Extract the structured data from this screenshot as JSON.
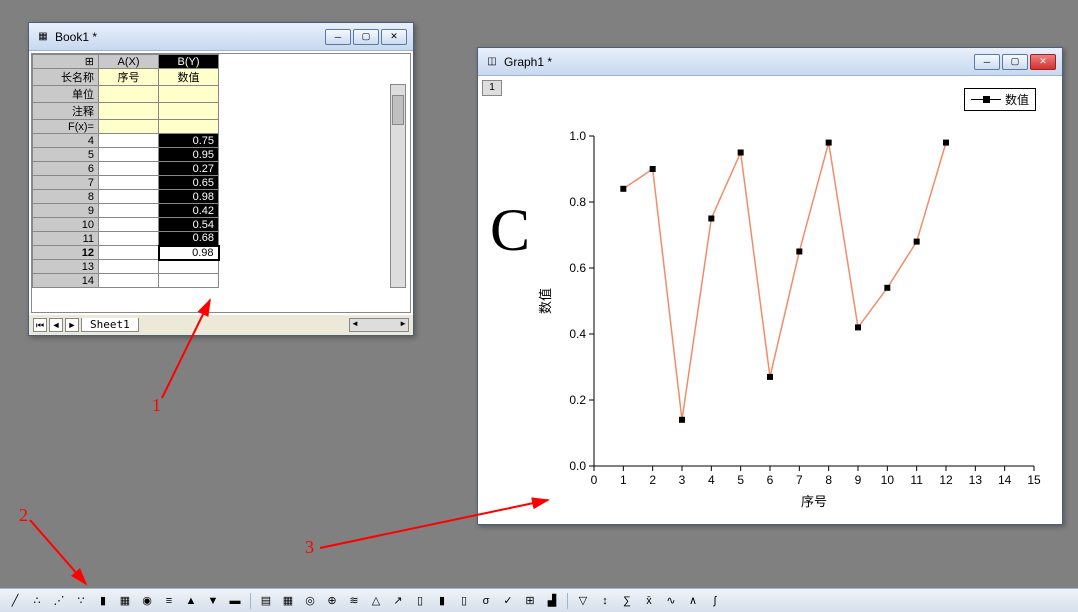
{
  "book_window": {
    "title": "Book1 *",
    "columns": {
      "a": "A(X)",
      "b": "B(Y)"
    },
    "label_rows": {
      "longname": "长名称",
      "units": "单位",
      "comments": "注释",
      "fx": "F(x)="
    },
    "longname_a": "序号",
    "longname_b": "数值",
    "row_numbers": [
      4,
      5,
      6,
      7,
      8,
      9,
      10,
      11,
      12,
      13,
      14
    ],
    "b_values": [
      "0.75",
      "0.95",
      "0.27",
      "0.65",
      "0.98",
      "0.42",
      "0.54",
      "0.68",
      "0.98",
      "",
      ""
    ],
    "selected_row_range": [
      4,
      12
    ],
    "sheet_tab": "Sheet1"
  },
  "graph_window": {
    "title": "Graph1 *",
    "layer": "1",
    "legend_label": "数值",
    "big_letter": "C",
    "xlabel": "序号",
    "ylabel": "数值"
  },
  "chart_data": {
    "type": "line",
    "title": "",
    "xlabel": "序号",
    "ylabel": "数值",
    "x": [
      1,
      2,
      3,
      4,
      5,
      6,
      7,
      8,
      9,
      10,
      11,
      12
    ],
    "values": [
      0.84,
      0.9,
      0.14,
      0.75,
      0.95,
      0.27,
      0.65,
      0.98,
      0.42,
      0.54,
      0.68,
      0.98
    ],
    "xlim": [
      0,
      15
    ],
    "ylim": [
      0.0,
      1.0
    ],
    "xticks": [
      0,
      1,
      2,
      3,
      4,
      5,
      6,
      7,
      8,
      9,
      10,
      11,
      12,
      13,
      14,
      15
    ],
    "yticks": [
      0.0,
      0.2,
      0.4,
      0.6,
      0.8,
      1.0
    ],
    "line_color": "#f28c6a",
    "marker_color": "#000000",
    "legend": "数值"
  },
  "annotations": {
    "label1": "1",
    "label2": "2",
    "label3": "3"
  },
  "toolbar_icons": [
    "line",
    "scatter",
    "line-scatter",
    "scatter-dash",
    "column",
    "surface",
    "pie",
    "stack",
    "area",
    "area2",
    "bar3d",
    "spacer",
    "matrix",
    "heatmap",
    "contour",
    "polar",
    "waterfall",
    "ternary",
    "vector",
    "box",
    "hist",
    "hist2",
    "prob",
    "qc",
    "pivot",
    "pareto",
    "spacer",
    "filter",
    "sort",
    "calc",
    "stats",
    "fit",
    "peak",
    "integ"
  ]
}
